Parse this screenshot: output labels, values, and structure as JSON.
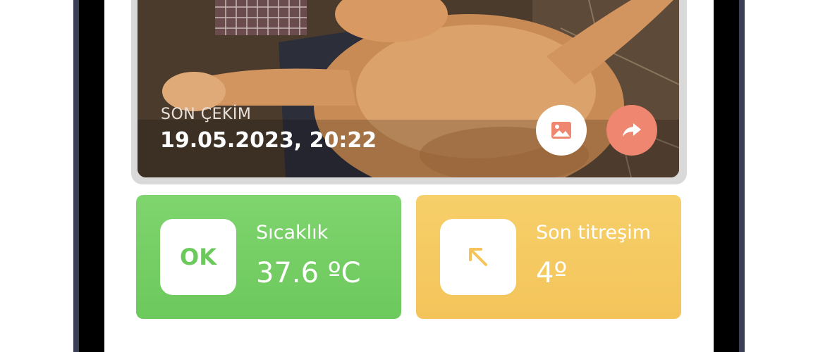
{
  "photo": {
    "caption_kicker": "SON ÇEKİM",
    "caption_date": "19.05.2023, 20:22",
    "gallery_icon": "image-icon",
    "share_icon": "share-icon"
  },
  "temperature": {
    "status": "OK",
    "label": "Sıcaklık",
    "value": "37.6 ºC",
    "color": "#6cc95c"
  },
  "vibration": {
    "icon": "arrow-up-left-icon",
    "label": "Son titreşim",
    "value": "4º",
    "color": "#f4c45a"
  },
  "colors": {
    "share_button": "#ee8670",
    "gallery_icon": "#ee8670"
  }
}
